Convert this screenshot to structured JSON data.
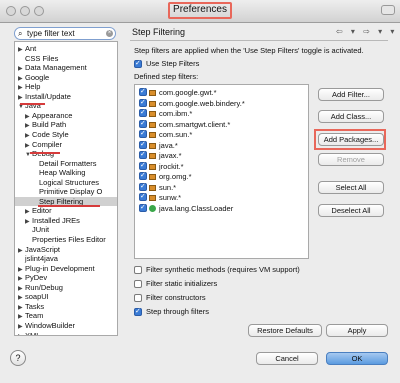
{
  "window": {
    "title": "Preferences"
  },
  "filter": {
    "value": "type filter text"
  },
  "tree": [
    {
      "label": "Ant",
      "arrow": "▶",
      "indent": 0
    },
    {
      "label": "CSS Files",
      "arrow": "",
      "indent": 0
    },
    {
      "label": "Data Management",
      "arrow": "▶",
      "indent": 0
    },
    {
      "label": "Google",
      "arrow": "▶",
      "indent": 0
    },
    {
      "label": "Help",
      "arrow": "▶",
      "indent": 0
    },
    {
      "label": "Install/Update",
      "arrow": "▶",
      "indent": 0
    },
    {
      "label": "Java",
      "arrow": "▼",
      "indent": 0
    },
    {
      "label": "Appearance",
      "arrow": "▶",
      "indent": 1
    },
    {
      "label": "Build Path",
      "arrow": "▶",
      "indent": 1
    },
    {
      "label": "Code Style",
      "arrow": "▶",
      "indent": 1
    },
    {
      "label": "Compiler",
      "arrow": "▶",
      "indent": 1
    },
    {
      "label": "Debug",
      "arrow": "▼",
      "indent": 1
    },
    {
      "label": "Detail Formatters",
      "arrow": "",
      "indent": 2
    },
    {
      "label": "Heap Walking",
      "arrow": "",
      "indent": 2
    },
    {
      "label": "Logical Structures",
      "arrow": "",
      "indent": 2
    },
    {
      "label": "Primitive Display O",
      "arrow": "",
      "indent": 2
    },
    {
      "label": "Step Filtering",
      "arrow": "",
      "indent": 2,
      "selected": true
    },
    {
      "label": "Editor",
      "arrow": "▶",
      "indent": 1
    },
    {
      "label": "Installed JREs",
      "arrow": "▶",
      "indent": 1
    },
    {
      "label": "JUnit",
      "arrow": "",
      "indent": 1
    },
    {
      "label": "Properties Files Editor",
      "arrow": "",
      "indent": 1
    },
    {
      "label": "JavaScript",
      "arrow": "▶",
      "indent": 0
    },
    {
      "label": "jslint4java",
      "arrow": "",
      "indent": 0
    },
    {
      "label": "Plug-in Development",
      "arrow": "▶",
      "indent": 0
    },
    {
      "label": "PyDev",
      "arrow": "▶",
      "indent": 0
    },
    {
      "label": "Run/Debug",
      "arrow": "▶",
      "indent": 0
    },
    {
      "label": "soapUI",
      "arrow": "▶",
      "indent": 0
    },
    {
      "label": "Tasks",
      "arrow": "▶",
      "indent": 0
    },
    {
      "label": "Team",
      "arrow": "▶",
      "indent": 0
    },
    {
      "label": "WindowBuilder",
      "arrow": "▶",
      "indent": 0
    },
    {
      "label": "XML",
      "arrow": "▶",
      "indent": 0
    }
  ],
  "page": {
    "title": "Step Filtering",
    "nav": "⇦ ▾ ⇨ ▾ ▾",
    "description": "Step filters are applied when the 'Use Step Filters' toggle is activated.",
    "use_step_filters": "Use Step Filters",
    "defined_label": "Defined step filters:",
    "filters": [
      {
        "label": "com.google.gwt.*",
        "kind": "pkg"
      },
      {
        "label": "com.google.web.bindery.*",
        "kind": "pkg"
      },
      {
        "label": "com.ibm.*",
        "kind": "pkg"
      },
      {
        "label": "com.smartgwt.client.*",
        "kind": "pkg"
      },
      {
        "label": "com.sun.*",
        "kind": "pkg"
      },
      {
        "label": "java.*",
        "kind": "pkg"
      },
      {
        "label": "javax.*",
        "kind": "pkg"
      },
      {
        "label": "jrockit.*",
        "kind": "pkg"
      },
      {
        "label": "org.omg.*",
        "kind": "pkg"
      },
      {
        "label": "sun.*",
        "kind": "pkg"
      },
      {
        "label": "sunw.*",
        "kind": "pkg"
      },
      {
        "label": "java.lang.ClassLoader",
        "kind": "class"
      }
    ],
    "buttons": {
      "add_filter": "Add Filter...",
      "add_class": "Add Class...",
      "add_packages": "Add Packages...",
      "remove": "Remove",
      "select_all": "Select All",
      "deselect_all": "Deselect All"
    },
    "options": {
      "synthetic": "Filter synthetic methods (requires VM support)",
      "static_init": "Filter static initializers",
      "constructors": "Filter constructors",
      "step_through": "Step through filters"
    },
    "restore_defaults": "Restore Defaults",
    "apply": "Apply"
  },
  "footer": {
    "help": "?",
    "cancel": "Cancel",
    "ok": "OK"
  },
  "colors": {
    "annotation_red": "#e8675a",
    "accent_blue": "#5b9be0"
  }
}
